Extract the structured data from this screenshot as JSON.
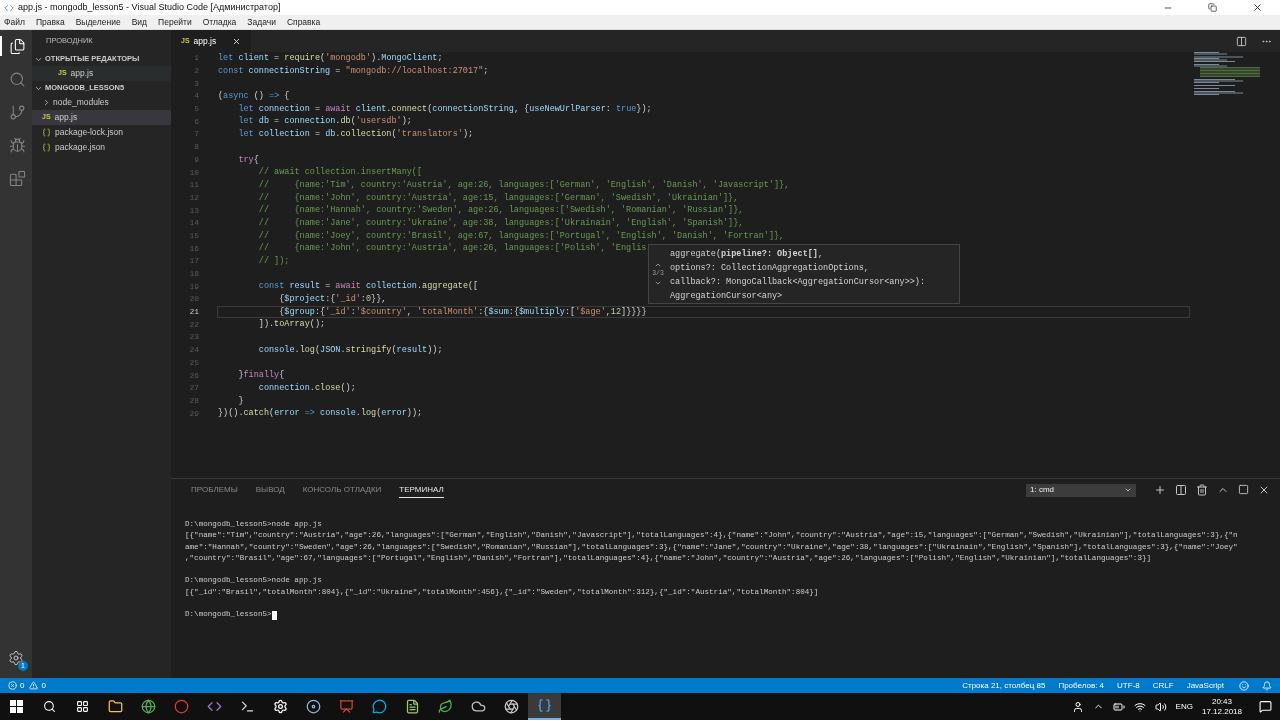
{
  "window": {
    "title": "app.js - mongodb_lesson5 - Visual Studio Code [Администратор]"
  },
  "menu": [
    "Файл",
    "Правка",
    "Выделение",
    "Вид",
    "Перейти",
    "Отладка",
    "Задачи",
    "Справка"
  ],
  "activity_bar": {
    "items": [
      {
        "kind": "files",
        "selected": true
      },
      {
        "kind": "search",
        "selected": false
      },
      {
        "kind": "git",
        "selected": false
      },
      {
        "kind": "debug",
        "selected": false
      },
      {
        "kind": "extensions",
        "selected": false
      }
    ],
    "badge": "1"
  },
  "sidebar": {
    "title": "ПРОВОДНИК",
    "sections": [
      {
        "title": "ОТКРЫТЫЕ РЕДАКТОРЫ",
        "expanded": true,
        "items": [
          {
            "label": "app.js",
            "kind": "js",
            "icon_label": "JS",
            "selected": true
          }
        ]
      },
      {
        "title": "MONGODB_LESSON5",
        "expanded": true,
        "items": [
          {
            "label": "node_modules",
            "kind": "folder",
            "selected": false
          },
          {
            "label": "app.js",
            "kind": "js",
            "icon_label": "JS",
            "selected": true
          },
          {
            "label": "package-lock.json",
            "kind": "json",
            "selected": false
          },
          {
            "label": "package.json",
            "kind": "json",
            "selected": false
          }
        ]
      }
    ]
  },
  "tabs": [
    {
      "label": "app.js",
      "kind": "js",
      "icon_label": "JS",
      "selected": true
    }
  ],
  "editor": {
    "lines": [
      {
        "n": "1",
        "active": false,
        "tokens": [
          {
            "kind": "kw",
            "text": "let "
          },
          {
            "kind": "var",
            "text": "client"
          },
          {
            "kind": "p",
            "text": " = "
          },
          {
            "kind": "fn",
            "text": "require"
          },
          {
            "kind": "p",
            "text": "("
          },
          {
            "kind": "str",
            "text": "'mongodb'"
          },
          {
            "kind": "p",
            "text": ")."
          },
          {
            "kind": "var",
            "text": "MongoClient"
          },
          {
            "kind": "p",
            "text": ";"
          }
        ]
      },
      {
        "n": "2",
        "active": false,
        "tokens": [
          {
            "kind": "kw",
            "text": "const "
          },
          {
            "kind": "var",
            "text": "connectionString"
          },
          {
            "kind": "p",
            "text": " = "
          },
          {
            "kind": "str",
            "text": "\"mongodb://localhost:27017\""
          },
          {
            "kind": "p",
            "text": ";"
          }
        ]
      },
      {
        "n": "3",
        "active": false
      },
      {
        "n": "4",
        "active": false,
        "tokens": [
          {
            "kind": "p",
            "text": "("
          },
          {
            "kind": "kw",
            "text": "async"
          },
          {
            "kind": "p",
            "text": " () "
          },
          {
            "kind": "kw",
            "text": "=>"
          },
          {
            "kind": "p",
            "text": " {"
          }
        ]
      },
      {
        "n": "5",
        "active": false,
        "tokens": [
          {
            "kind": "kw",
            "text": "    let "
          },
          {
            "kind": "var",
            "text": "connection"
          },
          {
            "kind": "p",
            "text": " = "
          },
          {
            "kind": "ctl",
            "text": "await "
          },
          {
            "kind": "var",
            "text": "client"
          },
          {
            "kind": "p",
            "text": "."
          },
          {
            "kind": "fn",
            "text": "connect"
          },
          {
            "kind": "p",
            "text": "("
          },
          {
            "kind": "var",
            "text": "connectionString"
          },
          {
            "kind": "p",
            "text": ", {"
          },
          {
            "kind": "var",
            "text": "useNewUrlParser"
          },
          {
            "kind": "p",
            "text": ": "
          },
          {
            "kind": "kw",
            "text": "true"
          },
          {
            "kind": "p",
            "text": "});"
          }
        ]
      },
      {
        "n": "6",
        "active": false,
        "tokens": [
          {
            "kind": "kw",
            "text": "    let "
          },
          {
            "kind": "var",
            "text": "db"
          },
          {
            "kind": "p",
            "text": " = "
          },
          {
            "kind": "var",
            "text": "connection"
          },
          {
            "kind": "p",
            "text": "."
          },
          {
            "kind": "fn",
            "text": "db"
          },
          {
            "kind": "p",
            "text": "("
          },
          {
            "kind": "str",
            "text": "'usersdb'"
          },
          {
            "kind": "p",
            "text": ");"
          }
        ]
      },
      {
        "n": "7",
        "active": false,
        "tokens": [
          {
            "kind": "kw",
            "text": "    let "
          },
          {
            "kind": "var",
            "text": "collection"
          },
          {
            "kind": "p",
            "text": " = "
          },
          {
            "kind": "var",
            "text": "db"
          },
          {
            "kind": "p",
            "text": "."
          },
          {
            "kind": "fn",
            "text": "collection"
          },
          {
            "kind": "p",
            "text": "("
          },
          {
            "kind": "str",
            "text": "'translators'"
          },
          {
            "kind": "p",
            "text": ");"
          }
        ]
      },
      {
        "n": "8",
        "active": false
      },
      {
        "n": "9",
        "active": false,
        "tokens": [
          {
            "kind": "ctl",
            "text": "    try"
          },
          {
            "kind": "p",
            "text": "{"
          }
        ]
      },
      {
        "n": "10",
        "active": false,
        "tokens": [
          {
            "kind": "cm",
            "text": "        // await collection.insertMany(["
          }
        ]
      },
      {
        "n": "11",
        "active": false,
        "tokens": [
          {
            "kind": "cm",
            "text": "        //     {name:'Tim', country:'Austria', age:26, languages:['German', 'English', 'Danish', 'Javascript']},"
          }
        ]
      },
      {
        "n": "12",
        "active": false,
        "tokens": [
          {
            "kind": "cm",
            "text": "        //     {name:'John', country:'Austria', age:15, languages:['German', 'Swedish', 'Ukrainian']},"
          }
        ]
      },
      {
        "n": "13",
        "active": false,
        "tokens": [
          {
            "kind": "cm",
            "text": "        //     {name:'Hannah', country:'Sweden', age:26, languages:['Swedish', 'Romanian', 'Russian']},"
          }
        ]
      },
      {
        "n": "14",
        "active": false,
        "tokens": [
          {
            "kind": "cm",
            "text": "        //     {name:'Jane', country:'Ukraine', age:38, languages:['Ukrainain', 'English', 'Spanish']},"
          }
        ]
      },
      {
        "n": "15",
        "active": false,
        "tokens": [
          {
            "kind": "cm",
            "text": "        //     {name:'Joey', country:'Brasil', age:67, languages:['Portugal', 'English', 'Danish', 'Fortran']},"
          }
        ]
      },
      {
        "n": "16",
        "active": false,
        "tokens": [
          {
            "kind": "cm",
            "text": "        //     {name:'John', country:'Austria', age:26, languages:['Polish', 'Englis"
          }
        ]
      },
      {
        "n": "17",
        "active": false,
        "tokens": [
          {
            "kind": "cm",
            "text": "        // ]);"
          }
        ]
      },
      {
        "n": "18",
        "active": false
      },
      {
        "n": "19",
        "active": false,
        "tokens": [
          {
            "kind": "kw",
            "text": "        const "
          },
          {
            "kind": "var",
            "text": "result"
          },
          {
            "kind": "p",
            "text": " = "
          },
          {
            "kind": "ctl",
            "text": "await "
          },
          {
            "kind": "var",
            "text": "collection"
          },
          {
            "kind": "p",
            "text": "."
          },
          {
            "kind": "fn",
            "text": "aggregate"
          },
          {
            "kind": "p",
            "text": "(["
          }
        ]
      },
      {
        "n": "20",
        "active": false,
        "tokens": [
          {
            "kind": "p",
            "text": "            {"
          },
          {
            "kind": "var",
            "text": "$project"
          },
          {
            "kind": "p",
            "text": ":{"
          },
          {
            "kind": "str",
            "text": "'_id'"
          },
          {
            "kind": "p",
            "text": ":"
          },
          {
            "kind": "num",
            "text": "0"
          },
          {
            "kind": "p",
            "text": "}},"
          }
        ]
      },
      {
        "n": "21",
        "active": true,
        "tokens": [
          {
            "kind": "p",
            "text": "            {"
          },
          {
            "kind": "var",
            "text": "$group"
          },
          {
            "kind": "p",
            "text": ":{"
          },
          {
            "kind": "str",
            "text": "'_id'"
          },
          {
            "kind": "p",
            "text": ":"
          },
          {
            "kind": "str",
            "text": "'$country'"
          },
          {
            "kind": "p",
            "text": ", "
          },
          {
            "kind": "str",
            "text": "'totalMonth'"
          },
          {
            "kind": "p",
            "text": ":{"
          },
          {
            "kind": "var",
            "text": "$sum"
          },
          {
            "kind": "p",
            "text": ":{"
          },
          {
            "kind": "var",
            "text": "$multiply"
          },
          {
            "kind": "p",
            "text": ":["
          },
          {
            "kind": "str",
            "text": "'$age'"
          },
          {
            "kind": "p",
            "text": ","
          },
          {
            "kind": "num",
            "text": "12"
          },
          {
            "kind": "p",
            "text": "]}}}}"
          }
        ]
      },
      {
        "n": "22",
        "active": false,
        "tokens": [
          {
            "kind": "p",
            "text": "        ])."
          },
          {
            "kind": "fn",
            "text": "toArray"
          },
          {
            "kind": "p",
            "text": "();"
          }
        ]
      },
      {
        "n": "23",
        "active": false
      },
      {
        "n": "24",
        "active": false,
        "tokens": [
          {
            "kind": "var",
            "text": "        console"
          },
          {
            "kind": "p",
            "text": "."
          },
          {
            "kind": "fn",
            "text": "log"
          },
          {
            "kind": "p",
            "text": "("
          },
          {
            "kind": "var",
            "text": "JSON"
          },
          {
            "kind": "p",
            "text": "."
          },
          {
            "kind": "fn",
            "text": "stringify"
          },
          {
            "kind": "p",
            "text": "("
          },
          {
            "kind": "var",
            "text": "result"
          },
          {
            "kind": "p",
            "text": "));"
          }
        ]
      },
      {
        "n": "25",
        "active": false
      },
      {
        "n": "26",
        "active": false,
        "tokens": [
          {
            "kind": "p",
            "text": "    }"
          },
          {
            "kind": "ctl",
            "text": "finally"
          },
          {
            "kind": "p",
            "text": "{"
          }
        ]
      },
      {
        "n": "27",
        "active": false,
        "tokens": [
          {
            "kind": "var",
            "text": "        connection"
          },
          {
            "kind": "p",
            "text": "."
          },
          {
            "kind": "fn",
            "text": "close"
          },
          {
            "kind": "p",
            "text": "();"
          }
        ]
      },
      {
        "n": "28",
        "active": false,
        "tokens": [
          {
            "kind": "p",
            "text": "    }"
          }
        ]
      },
      {
        "n": "29",
        "active": false,
        "tokens": [
          {
            "kind": "p",
            "text": "})()."
          },
          {
            "kind": "fn",
            "text": "catch"
          },
          {
            "kind": "p",
            "text": "("
          },
          {
            "kind": "var",
            "text": "error"
          },
          {
            "kind": "kw",
            "text": " => "
          },
          {
            "kind": "var",
            "text": "console"
          },
          {
            "kind": "p",
            "text": "."
          },
          {
            "kind": "fn",
            "text": "log"
          },
          {
            "kind": "p",
            "text": "("
          },
          {
            "kind": "var",
            "text": "error"
          },
          {
            "kind": "p",
            "text": "));"
          }
        ]
      }
    ]
  },
  "hover": {
    "counter": "3/3",
    "lines": [
      "aggregate(**pipeline?: Object[]**,",
      "options?: CollectionAggregationOptions,",
      "callback?: MongoCallback<AggregationCursor<any>>):",
      "AggregationCursor<any>"
    ]
  },
  "panel": {
    "tabs": [
      {
        "label": "ПРОБЛЕМЫ",
        "selected": false
      },
      {
        "label": "ВЫВОД",
        "selected": false
      },
      {
        "label": "КОНСОЛЬ ОТЛАДКИ",
        "selected": false
      },
      {
        "label": "ТЕРМИНАЛ",
        "selected": true
      }
    ],
    "terminal_select": "1: cmd",
    "blocks": [
      [
        "D:\\mongodb_lesson5>node app.js",
        "[{\"name\":\"Tim\",\"country\":\"Austria\",\"age\":26,\"languages\":[\"German\",\"English\",\"Danish\",\"Javascript\"],\"totalLanguages\":4},{\"name\":\"John\",\"country\":\"Austria\",\"age\":15,\"languages\":[\"German\",\"Swedish\",\"Ukrainian\"],\"totalLanguages\":3},{\"n",
        "ame\":\"Hannah\",\"country\":\"Sweden\",\"age\":26,\"languages\":[\"Swedish\",\"Romanian\",\"Russian\"],\"totalLanguages\":3},{\"name\":\"Jane\",\"country\":\"Ukraine\",\"age\":38,\"languages\":[\"Ukrainain\",\"English\",\"Spanish\"],\"totalLanguages\":3},{\"name\":\"Joey\"",
        ",\"country\":\"Brasil\",\"age\":67,\"languages\":[\"Portugal\",\"English\",\"Danish\",\"Fortran\"],\"totalLanguages\":4},{\"name\":\"John\",\"country\":\"Austria\",\"age\":26,\"languages\":[\"Polish\",\"English\",\"Ukrainian\"],\"totalLanguages\":3}]"
      ],
      [
        "D:\\mongodb_lesson5>node app.js",
        "[{\"_id\":\"Brasil\",\"totalMonth\":804},{\"_id\":\"Ukraine\",\"totalMonth\":456},{\"_id\":\"Sweden\",\"totalMonth\":312},{\"_id\":\"Austria\",\"totalMonth\":804}]"
      ],
      [
        "D:\\mongodb_lesson5>"
      ]
    ]
  },
  "status_bar": {
    "errors": "0",
    "warnings": "0",
    "items": [
      "Строка 21, столбец 85",
      "Пробелов: 4",
      "UTF-8",
      "CRLF",
      "JavaScript"
    ]
  },
  "taskbar": {
    "apps": [
      {
        "kind": "folder",
        "selected": false
      },
      {
        "kind": "globe",
        "selected": false
      },
      {
        "kind": "ring",
        "selected": false
      },
      {
        "kind": "code",
        "selected": false
      },
      {
        "kind": "terminal",
        "selected": false
      },
      {
        "kind": "gear",
        "selected": false
      },
      {
        "kind": "disc",
        "selected": false
      },
      {
        "kind": "slides",
        "selected": false
      },
      {
        "kind": "chat",
        "selected": false
      },
      {
        "kind": "notepad",
        "selected": false
      },
      {
        "kind": "leaf",
        "selected": false
      },
      {
        "kind": "cloud",
        "selected": false
      },
      {
        "kind": "aperture",
        "selected": false
      },
      {
        "kind": "editor",
        "selected": true
      }
    ],
    "language": "ENG",
    "time": "20:43",
    "date": "17.12.2018"
  }
}
